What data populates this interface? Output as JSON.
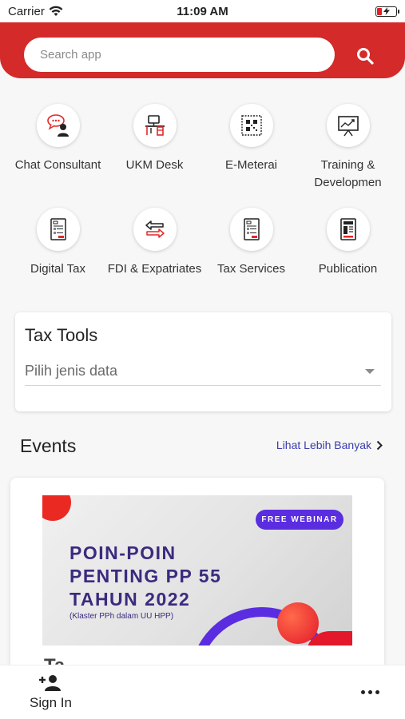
{
  "status_bar": {
    "carrier": "Carrier",
    "time": "11:09 AM",
    "battery_charging": true
  },
  "header": {
    "search_placeholder": "Search app",
    "accent_color": "#d42a2a"
  },
  "apps": [
    {
      "label": "Chat Consultant",
      "icon": "chat-consultant-icon"
    },
    {
      "label": "UKM Desk",
      "icon": "desk-icon"
    },
    {
      "label": "E-Meterai",
      "icon": "stamp-qr-icon"
    },
    {
      "label": "Training & Developmen",
      "icon": "presentation-chart-icon"
    },
    {
      "label": "Digital Tax",
      "icon": "tax-document-icon"
    },
    {
      "label": "FDI & Expatriates",
      "icon": "exchange-arrows-icon"
    },
    {
      "label": "Tax Services",
      "icon": "tax-document-icon"
    },
    {
      "label": "Publication",
      "icon": "newspaper-icon"
    }
  ],
  "tax_tools": {
    "title": "Tax Tools",
    "select_value": "Pilih jenis data"
  },
  "events": {
    "title": "Events",
    "see_more": "Lihat Lebih Banyak",
    "card": {
      "badge": "FREE WEBINAR",
      "headline": "POIN-POIN PENTING PP 55 TAHUN 2022",
      "subtitle": "(Klaster PPh dalam UU HPP)",
      "title_peek": "Ta..."
    }
  },
  "bottom_bar": {
    "sign_in": "Sign In"
  }
}
